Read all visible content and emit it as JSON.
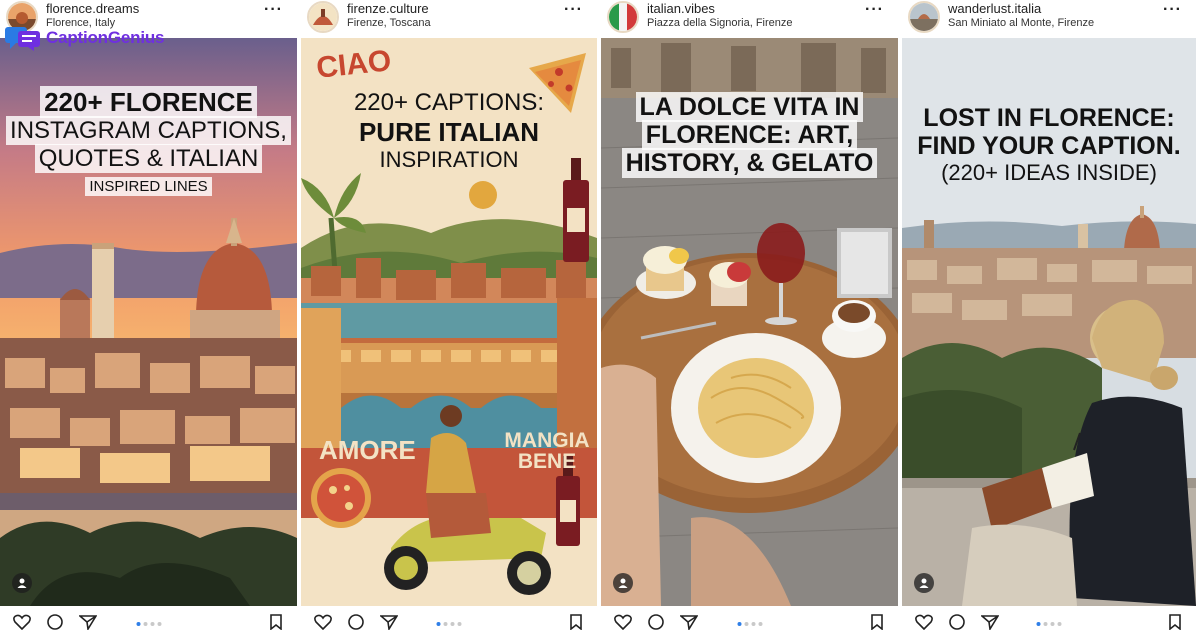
{
  "brand": {
    "name": "CaptionGenius"
  },
  "posts": [
    {
      "username": "florence.dreams",
      "location": "Florence, Italy",
      "headline": [
        "220+ FLORENCE",
        "INSTAGRAM CAPTIONS,",
        "QUOTES & ITALIAN"
      ],
      "subline": "INSPIRED LINES"
    },
    {
      "username": "firenze.culture",
      "location": "Firenze, Toscana",
      "corner_word": "CIAO",
      "headline_light": "220+ CAPTIONS:",
      "headline_bold": "PURE ITALIAN",
      "headline_tail": "INSPIRATION",
      "word_left": "AMORE",
      "word_right_1": "MANGIA",
      "word_right_2": "BENE"
    },
    {
      "username": "italian.vibes",
      "location": "Piazza della Signoria, Firenze",
      "headline": [
        "LA DOLCE VITA IN",
        "FLORENCE: ART,",
        "HISTORY, & GELATO"
      ]
    },
    {
      "username": "wanderlust.italia",
      "location": "San Miniato al Monte, Firenze",
      "headline": [
        "LOST IN FLORENCE:",
        "FIND YOUR CAPTION."
      ],
      "subline": "(220+ IDEAS INSIDE)"
    }
  ],
  "icons": {
    "more": "more-options-icon",
    "like": "heart-icon",
    "comment": "comment-icon",
    "share": "send-icon",
    "save": "bookmark-icon",
    "user_tag": "user-tag-icon"
  },
  "colors": {
    "brand_purple": "#6f2fe0",
    "brand_blue": "#2a7be4",
    "carousel_dot_active": "#2f7fe8"
  }
}
